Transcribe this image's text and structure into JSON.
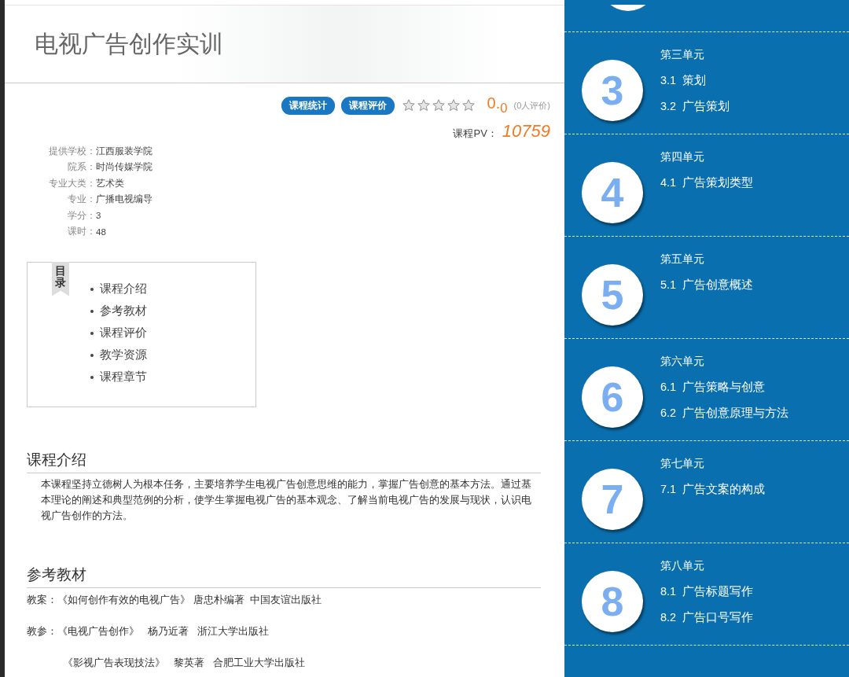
{
  "course_title": "电视广告创作实训",
  "actions": [
    {
      "label": "课程统计"
    },
    {
      "label": "课程评价"
    }
  ],
  "rating": {
    "stars": 0,
    "score": "0.$_{0}$",
    "count": "(0人评价)"
  },
  "pv": {
    "label": "课程PV：",
    "value": "10759"
  },
  "info": [
    {
      "label": "提供学校：",
      "value": "江西服装学院"
    },
    {
      "label": "院系：",
      "value": "时尚传媒学院"
    },
    {
      "label": "专业大类：",
      "value": "艺术类"
    },
    {
      "label": "专业：",
      "value": "广播电视编导"
    },
    {
      "label": "学分：",
      "value": "3"
    },
    {
      "label": "课时：",
      "value": "48"
    }
  ],
  "toc": {
    "tag": "目录",
    "items": [
      "课程介绍",
      "参考教材",
      "课程评价",
      "教学资源",
      "课程章节"
    ]
  },
  "intro": {
    "heading": "课程介绍",
    "text": "本课程坚持立德树人为根本任务，主要培养学生电视广告创意思维的能力，掌握广告创意的基本方法。通过基本理论的阐述和典型范例的分析，使学生掌握电视广告的基本观念、了解当前电视广告的发展与现状，认识电视广告创作的方法。"
  },
  "references": {
    "heading": "参考教材",
    "entries": [
      {
        "label": "教案：",
        "text": "《如何创作有效的电视广告》 唐忠朴编著  中国友谊出版社"
      },
      {
        "label": "教参：",
        "text": "《电视广告创作》   杨乃近著   浙江大学出版社"
      },
      {
        "text": "《影视广告表现技法》   黎英著   合肥工业大学出版社"
      }
    ]
  },
  "units": [
    {
      "number": "3",
      "title": "第三单元",
      "lessons": [
        "3.1  策划",
        "3.2  广告策划"
      ]
    },
    {
      "number": "4",
      "title": "第四单元",
      "lessons": [
        "4.1  广告策划类型"
      ]
    },
    {
      "number": "5",
      "title": "第五单元",
      "lessons": [
        "5.1  广告创意概述"
      ]
    },
    {
      "number": "6",
      "title": "第六单元",
      "lessons": [
        "6.1  广告策略与创意",
        "6.2  广告创意原理与方法"
      ]
    },
    {
      "number": "7",
      "title": "第七单元",
      "lessons": [
        "7.1  广告文案的构成"
      ]
    },
    {
      "number": "8",
      "title": "第八单元",
      "lessons": [
        "8.1  广告标题写作",
        "8.2  广告口号写作"
      ]
    }
  ]
}
